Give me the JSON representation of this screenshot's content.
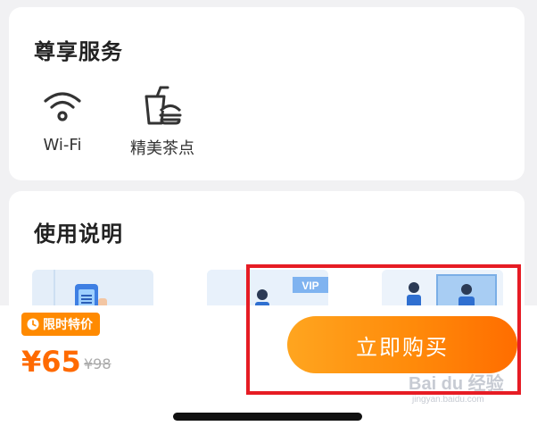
{
  "services": {
    "title": "尊享服务",
    "items": [
      {
        "label": "Wi-Fi",
        "icon": "wifi-icon"
      },
      {
        "label": "精美茶点",
        "icon": "tea-snack-icon"
      }
    ]
  },
  "usage": {
    "title": "使用说明",
    "illustrations": [
      {
        "icon": "phone-qrcode-illustration"
      },
      {
        "icon": "vip-lounge-illustration",
        "badge": "VIP"
      },
      {
        "icon": "service-desk-illustration"
      }
    ]
  },
  "purchase": {
    "badge_label": "限时特价",
    "price": "¥65",
    "original_price": "¥98",
    "buy_label": "立即购买"
  },
  "watermark": {
    "brand": "Bai du 经验",
    "url": "jingyan.baidu.com"
  },
  "colors": {
    "accent": "#ff8a00",
    "price": "#ff6a00",
    "highlight": "#e61c24"
  }
}
